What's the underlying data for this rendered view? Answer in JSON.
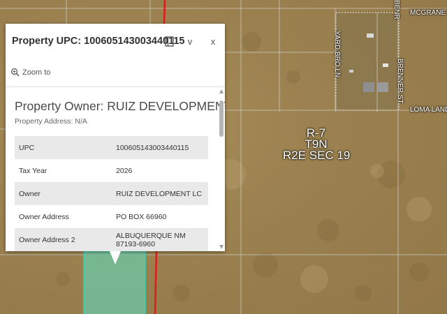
{
  "map": {
    "section_label": [
      "R-7",
      "T9N",
      "R2E SEC 19"
    ],
    "roads": {
      "mcgrane": "MCGRANE RD",
      "yard_bros": "YARD BRO LN",
      "brenner": "BRENNER ST",
      "benr": "BENR",
      "loma_land": "LOMA LAND R"
    },
    "colors": {
      "parcel_line": "#d4d4d4",
      "highlight_fill": "#6dc4a1",
      "highlight_stroke": "#2fd6bb",
      "red_line": "#e01b1b"
    }
  },
  "popup": {
    "title": "Property UPC: 100605143003440115",
    "icons": [
      "dock-icon",
      "chevron-down-icon",
      "close-icon"
    ],
    "close_glyph": "x",
    "collapse_glyph": "v",
    "zoom_label": "Zoom to",
    "owner_heading": "Property Owner: RUIZ DEVELOPMENT LC",
    "address_line": "Property Address: N/A",
    "rows": [
      {
        "label": "UPC",
        "value": "100605143003440115"
      },
      {
        "label": "Tax Year",
        "value": "2026"
      },
      {
        "label": "Owner",
        "value": "RUIZ DEVELOPMENT LC"
      },
      {
        "label": "Owner Address",
        "value": "PO BOX 66960"
      },
      {
        "label": "Owner Address 2",
        "value": "ALBUQUERQUE NM 87193-6960"
      }
    ]
  }
}
